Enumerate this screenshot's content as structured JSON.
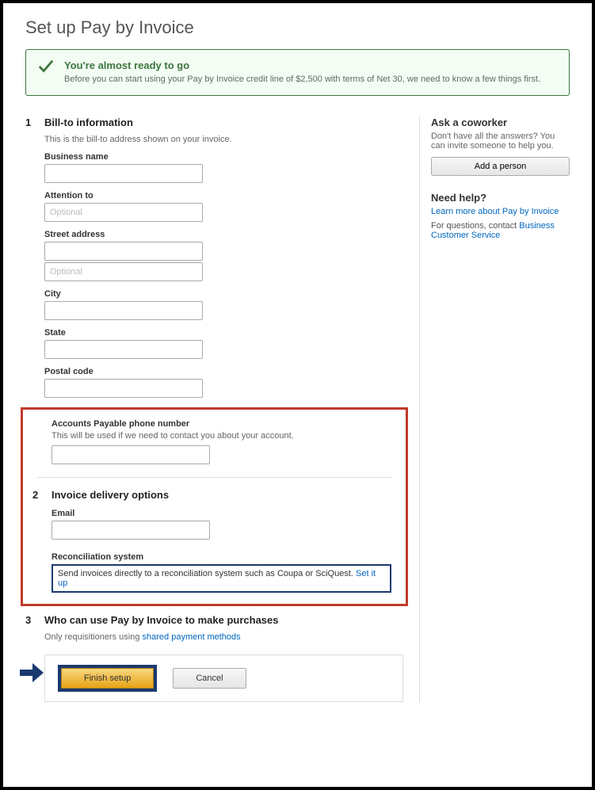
{
  "page": {
    "title": "Set up Pay by Invoice"
  },
  "alert": {
    "title": "You're almost ready to go",
    "body": "Before you can start using your Pay by Invoice credit line of $2,500 with terms of Net 30, we need to know a few things first."
  },
  "section1": {
    "num": "1",
    "title": "Bill-to information",
    "desc": "This is the bill-to address shown on your invoice.",
    "fields": {
      "business_name": {
        "label": "Business name",
        "value": "",
        "placeholder": ""
      },
      "attention_to": {
        "label": "Attention to",
        "value": "",
        "placeholder": "Optional"
      },
      "street1": {
        "label": "Street address",
        "value": "",
        "placeholder": ""
      },
      "street2": {
        "value": "",
        "placeholder": "Optional"
      },
      "city": {
        "label": "City",
        "value": ""
      },
      "state": {
        "label": "State",
        "value": ""
      },
      "postal": {
        "label": "Postal code",
        "value": ""
      }
    },
    "ap_phone": {
      "label": "Accounts Payable phone number",
      "desc": "This will be used if we need to contact you about your account.",
      "value": ""
    }
  },
  "section2": {
    "num": "2",
    "title": "Invoice delivery options",
    "email": {
      "label": "Email",
      "value": ""
    },
    "recon": {
      "label": "Reconciliation system",
      "text": "Send invoices directly to a reconciliation system such as Coupa or SciQuest. ",
      "link": "Set it up"
    }
  },
  "section3": {
    "num": "3",
    "title": "Who can use Pay by Invoice to make purchases",
    "desc_prefix": "Only requisitioners using ",
    "desc_link": "shared payment methods"
  },
  "sidebar": {
    "ask": {
      "title": "Ask a coworker",
      "desc": "Don't have all the answers? You can invite someone to help you.",
      "button": "Add a person"
    },
    "help": {
      "title": "Need help?",
      "learn_link": "Learn more about Pay by Invoice",
      "questions_prefix": "For questions, contact ",
      "questions_link": "Business Customer Service"
    }
  },
  "footer": {
    "finish": "Finish setup",
    "cancel": "Cancel"
  }
}
